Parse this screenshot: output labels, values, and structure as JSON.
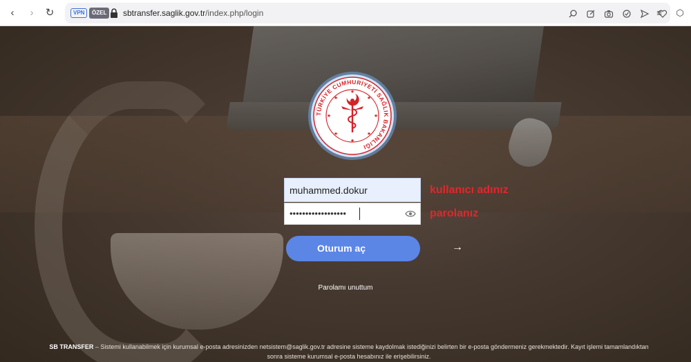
{
  "browser": {
    "vpn_badge": "VPN",
    "private_badge": "ÖZEL",
    "url_host": "sbtransfer.saglik.gov.tr",
    "url_path": "/index.php/login",
    "icons": [
      "back-icon",
      "forward-icon",
      "reload-icon",
      "lock-icon",
      "search-icon",
      "edit-icon",
      "camera-icon",
      "shield-check-icon",
      "send-icon",
      "heart-icon",
      "menu-icon",
      "extension-icon"
    ]
  },
  "logo": {
    "text": "TÜRKİYE CUMHURİYETİ SAĞLIK BAKANLIĞI"
  },
  "form": {
    "username_value": "muhammed.dokur",
    "password_value": "••••••••••••••••••",
    "username_annotation": "kullanıcı adınız",
    "password_annotation": "parolanız",
    "login_label": "Oturum aç",
    "forgot_label": "Parolamı unuttum"
  },
  "footer": {
    "brand": "SB TRANSFER",
    "line1": " – Sistemi kullanabilmek için kurumsal e-posta adresinizden netsistem@saglik.gov.tr adresine sisteme kaydolmak istediğinizi belirten bir e-posta göndermeniz gerekmektedir. Kayıt işlemi tamamlandıktan",
    "line2": "sonra sisteme kurumsal e-posta hesabınız ile erişebilirsiniz."
  },
  "colors": {
    "accent": "#5b86e5",
    "annotation": "#e3262b"
  }
}
